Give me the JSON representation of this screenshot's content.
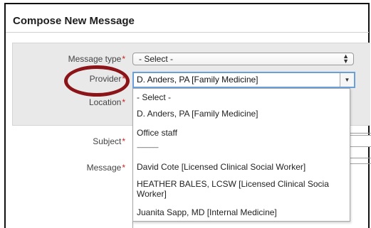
{
  "form": {
    "title": "Compose New Message",
    "required_mark": "*",
    "message_type": {
      "label": "Message type",
      "value": "- Select -"
    },
    "provider": {
      "label": "Provider",
      "value": "D. Anders, PA [Family Medicine]"
    },
    "location": {
      "label": "Location"
    },
    "subject": {
      "label": "Subject"
    },
    "message": {
      "label": "Message"
    }
  },
  "provider_dropdown": {
    "options": [
      "- Select -",
      "D. Anders, PA [Family Medicine]",
      "Office staff",
      "------------------",
      "David Cote [Licensed Clinical Social Worker]",
      "HEATHER BALES, LCSW [Licensed Clinical Socia",
      "Worker]",
      "Juanita Sapp, MD [Internal Medicine]"
    ]
  },
  "colors": {
    "required": "#cc1f1f",
    "highlight_ring": "#8b1418",
    "focus_border": "#6b9fd8"
  }
}
